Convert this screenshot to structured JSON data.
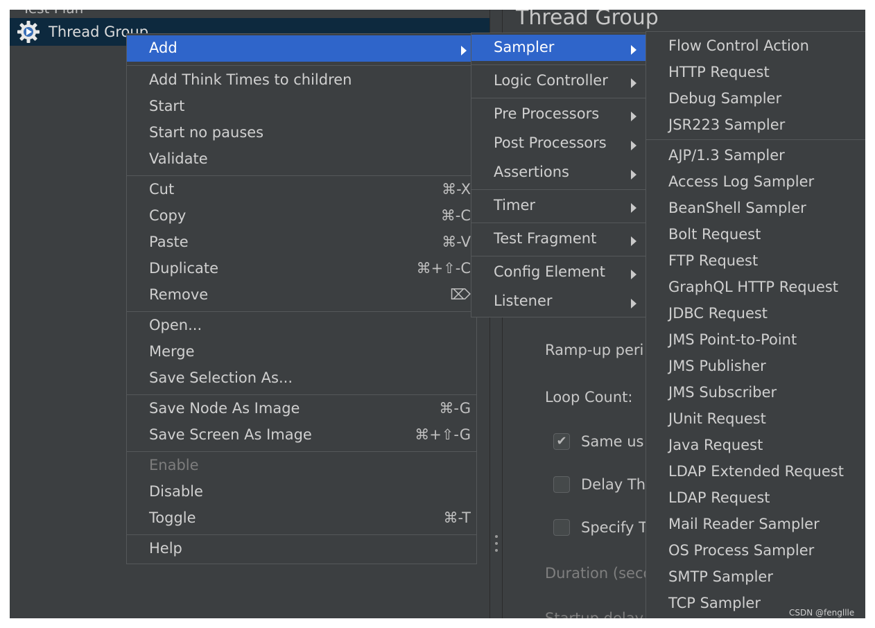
{
  "tree": {
    "parent_label": "Test Plan",
    "selected_label": "Thread Group"
  },
  "panel": {
    "title": "Thread Group",
    "ramp_up_label": "Ramp-up peri",
    "loop_count_label": "Loop Count:",
    "same_user_label": "Same us",
    "same_user_checked": true,
    "delay_label": "Delay Th",
    "specify_label": "Specify T",
    "duration_label": "Duration (seco",
    "startup_label": "Startup delay (seco"
  },
  "context_menu": {
    "items": [
      {
        "label": "Add",
        "shortcut": "",
        "submenu": true
      },
      {
        "label": "Add Think Times to children",
        "shortcut": ""
      },
      {
        "label": "Start",
        "shortcut": ""
      },
      {
        "label": "Start no pauses",
        "shortcut": ""
      },
      {
        "label": "Validate",
        "shortcut": ""
      },
      {
        "label": "Cut",
        "shortcut": "⌘-X"
      },
      {
        "label": "Copy",
        "shortcut": "⌘-C"
      },
      {
        "label": "Paste",
        "shortcut": "⌘-V"
      },
      {
        "label": "Duplicate",
        "shortcut": "⌘+⇧-C"
      },
      {
        "label": "Remove",
        "shortcut": "⌦"
      },
      {
        "label": "Open...",
        "shortcut": ""
      },
      {
        "label": "Merge",
        "shortcut": ""
      },
      {
        "label": "Save Selection As...",
        "shortcut": ""
      },
      {
        "label": "Save Node As Image",
        "shortcut": "⌘-G"
      },
      {
        "label": "Save Screen As Image",
        "shortcut": "⌘+⇧-G"
      },
      {
        "label": "Enable",
        "shortcut": "",
        "disabled": true
      },
      {
        "label": "Disable",
        "shortcut": ""
      },
      {
        "label": "Toggle",
        "shortcut": "⌘-T"
      },
      {
        "label": "Help",
        "shortcut": ""
      }
    ]
  },
  "add_submenu": {
    "items": [
      {
        "label": "Sampler"
      },
      {
        "label": "Logic Controller"
      },
      {
        "label": "Pre Processors"
      },
      {
        "label": "Post Processors"
      },
      {
        "label": "Assertions"
      },
      {
        "label": "Timer"
      },
      {
        "label": "Test Fragment"
      },
      {
        "label": "Config Element"
      },
      {
        "label": "Listener"
      }
    ]
  },
  "sampler_submenu": {
    "items": [
      {
        "label": "Flow Control Action"
      },
      {
        "label": "HTTP Request"
      },
      {
        "label": "Debug Sampler"
      },
      {
        "label": "JSR223 Sampler"
      },
      {
        "label": "AJP/1.3 Sampler"
      },
      {
        "label": "Access Log Sampler"
      },
      {
        "label": "BeanShell Sampler"
      },
      {
        "label": "Bolt Request"
      },
      {
        "label": "FTP Request"
      },
      {
        "label": "GraphQL HTTP Request"
      },
      {
        "label": "JDBC Request"
      },
      {
        "label": "JMS Point-to-Point"
      },
      {
        "label": "JMS Publisher"
      },
      {
        "label": "JMS Subscriber"
      },
      {
        "label": "JUnit Request"
      },
      {
        "label": "Java Request"
      },
      {
        "label": "LDAP Extended Request"
      },
      {
        "label": "LDAP Request"
      },
      {
        "label": "Mail Reader Sampler"
      },
      {
        "label": "OS Process Sampler"
      },
      {
        "label": "SMTP Sampler"
      },
      {
        "label": "TCP Sampler"
      }
    ]
  },
  "watermark": "CSDN @fengllle",
  "colors": {
    "background": "#3c3f41",
    "selection": "#2f65ca",
    "tree_selection": "#0d293e",
    "text": "#d0d0d0",
    "disabled_text": "#7d7d7d"
  }
}
